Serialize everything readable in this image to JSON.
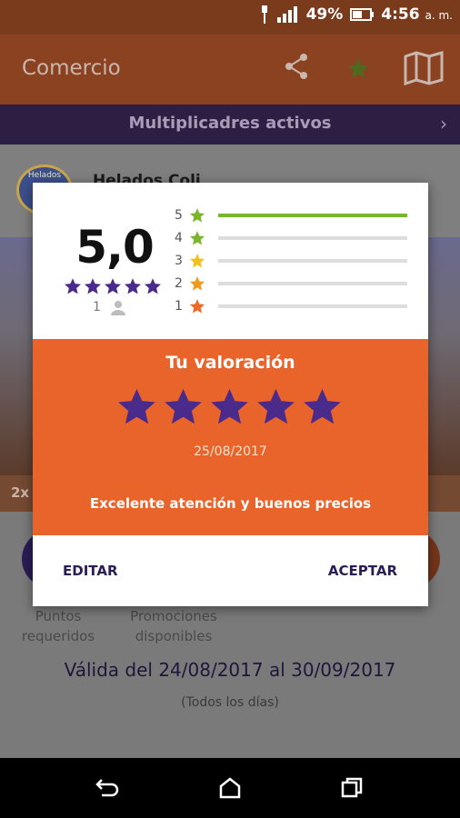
{
  "status_bar": {
    "battery": "49%",
    "time": "4:56",
    "ampm": "a. m."
  },
  "app_bar": {
    "title": "Comercio",
    "share_icon": "share-icon",
    "favorite_icon": "star-icon",
    "map_icon": "map-icon"
  },
  "multiplier_bar": {
    "label": "Multiplicadres activos"
  },
  "shop": {
    "name": "Helados Coli",
    "logo_text": "Helados"
  },
  "promo": {
    "label": "2x"
  },
  "info": {
    "points_label_1": "Puntos",
    "points_label_2": "requeridos",
    "promos_label_1": "Promociones",
    "promos_label_2": "disponibles",
    "validity": "Válida del 24/08/2017 al 30/09/2017",
    "days": "(Todos los días)"
  },
  "rating_dialog": {
    "score": "5,0",
    "summary_stars": 5,
    "review_count": "1",
    "distribution": [
      {
        "stars": "5",
        "fraction": 1.0,
        "color": "#7cb52b"
      },
      {
        "stars": "4",
        "fraction": 0,
        "color": "#7cb52b"
      },
      {
        "stars": "3",
        "fraction": 0,
        "color": "#f2c21b"
      },
      {
        "stars": "2",
        "fraction": 0,
        "color": "#f29a1b"
      },
      {
        "stars": "1",
        "fraction": 0,
        "color": "#ee6a24"
      }
    ],
    "my_rating": {
      "title": "Tu valoración",
      "stars": 5,
      "date": "25/08/2017",
      "comment": "Excelente atención y buenos precios"
    },
    "edit_label": "EDITAR",
    "accept_label": "ACEPTAR"
  },
  "colors": {
    "accent_purple": "#4a2a8a",
    "orange": "#e9642b",
    "green": "#7cb52b"
  }
}
